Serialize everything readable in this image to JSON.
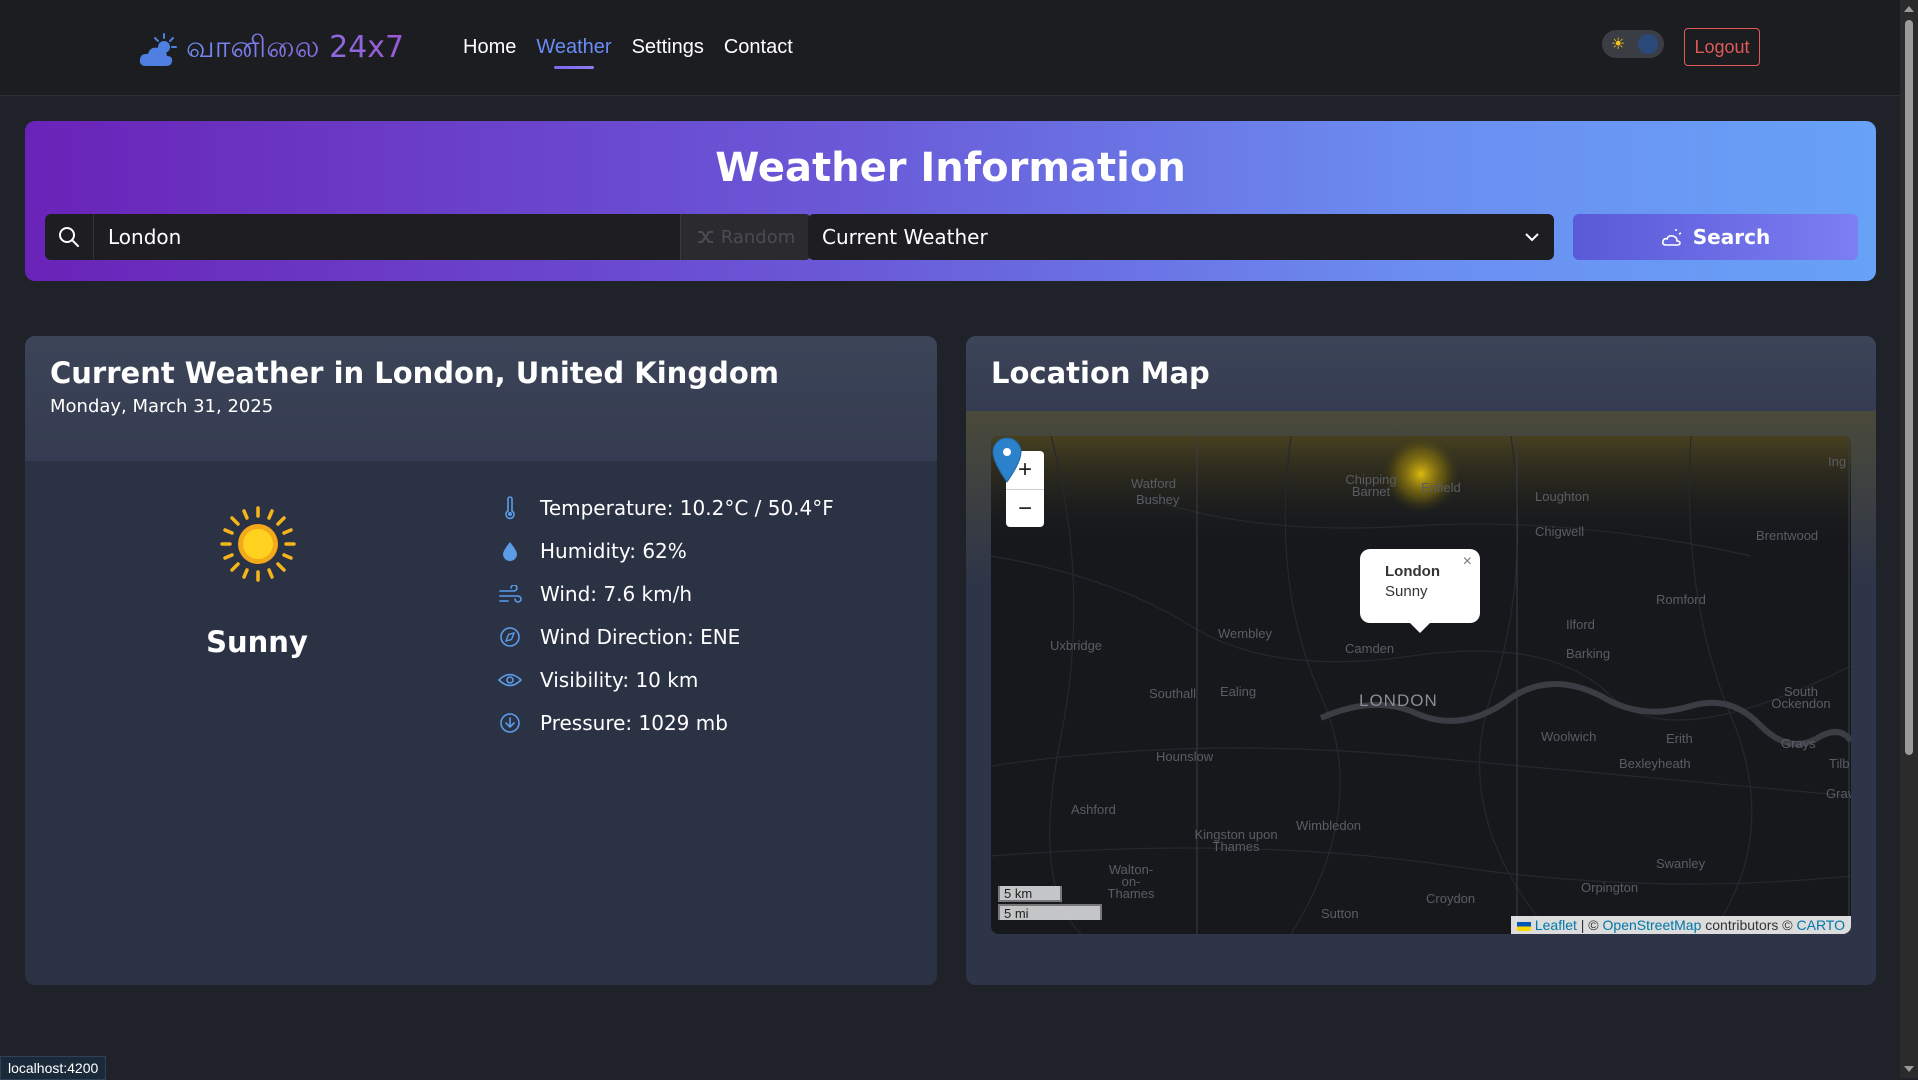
{
  "nav": {
    "brand": "வானிலை 24x7",
    "links": [
      "Home",
      "Weather",
      "Settings",
      "Contact"
    ],
    "active": "Weather",
    "logout": "Logout"
  },
  "hero": {
    "title": "Weather Information",
    "search_value": "London",
    "random_label": "Random",
    "select_value": "Current Weather",
    "search_button": "Search"
  },
  "weather": {
    "title": "Current Weather in London, United Kingdom",
    "date": "Monday, March 31, 2025",
    "condition": "Sunny",
    "details": [
      {
        "icon": "thermometer-icon",
        "text": "Temperature: 10.2°C / 50.4°F"
      },
      {
        "icon": "humidity-drop-icon",
        "text": "Humidity: 62%"
      },
      {
        "icon": "wind-icon",
        "text": "Wind: 7.6 km/h"
      },
      {
        "icon": "compass-icon",
        "text": "Wind Direction: ENE"
      },
      {
        "icon": "eye-icon",
        "text": "Visibility: 10 km"
      },
      {
        "icon": "pressure-down-icon",
        "text": "Pressure: 1029 mb"
      }
    ]
  },
  "map": {
    "title": "Location Map",
    "zoom_in": "+",
    "zoom_out": "−",
    "popup_city": "London",
    "popup_condition": "Sunny",
    "popup_close": "×",
    "scale_km": "5 km",
    "scale_mi": "5 mi",
    "attribution": {
      "leaflet": "Leaflet",
      "sep": " | © ",
      "osm": "OpenStreetMap",
      "contributors": " contributors © ",
      "carto": "CARTO"
    },
    "places": [
      "Watford",
      "Bushey",
      "Chipping Barnet",
      "Enfield",
      "Loughton",
      "Chigwell",
      "Brentwood",
      "Romford",
      "Ilford",
      "Barking",
      "Wembley",
      "Camden",
      "Uxbridge",
      "Southall",
      "Ealing",
      "LONDON",
      "South Ockendon",
      "Woolwich",
      "Erith",
      "Grays",
      "Bexleyheath",
      "Hounslow",
      "Ashford",
      "Kingston upon Thames",
      "Wimbledon",
      "Walton-on-Thames",
      "Croydon",
      "Sutton",
      "Orpington",
      "Swanley",
      "Ing",
      "Tilb",
      "Grav"
    ]
  },
  "status_url": "localhost:4200",
  "colors": {
    "accent": "#6a8cf7",
    "logout": "#e05a5a",
    "sun": "#f5c518"
  }
}
